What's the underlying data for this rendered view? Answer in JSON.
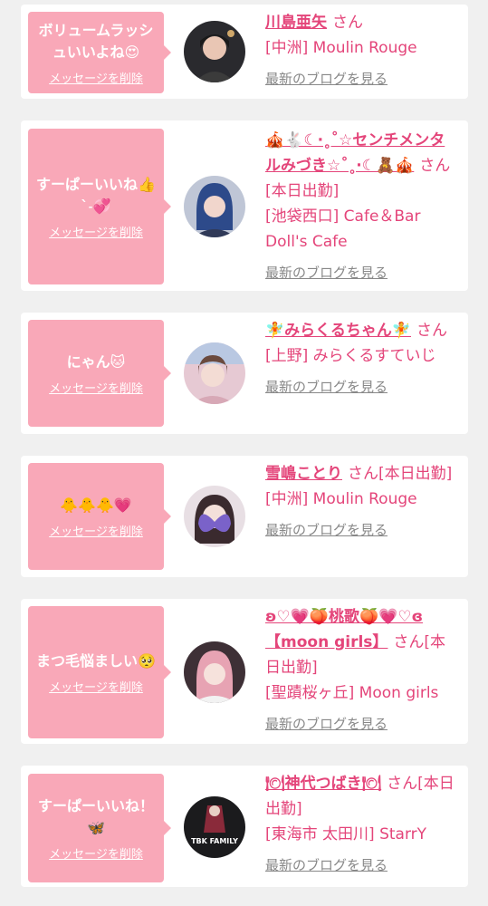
{
  "colors": {
    "page_bg": "#f0f0f0",
    "bubble_bg": "#f9a8b8",
    "accent_pink": "#e4457a",
    "link_gray": "#888888"
  },
  "common": {
    "delete_label": "メッセージを削除",
    "blog_label": "最新のブログを見る",
    "san": "さん"
  },
  "cards": [
    {
      "message": "ボリュームラッシュいいよね😍",
      "name": "川島亜矢",
      "status": "",
      "shop": "[中洲] Moulin Rouge",
      "avatar_icon": "woman-photo-avatar"
    },
    {
      "message": "すーぱーいいね👍 ˋ˗💞",
      "name": "🎪🐇☾·˳˚☆センチメンタルみづき☆˚˳·☾🧸🎪",
      "status": "[本日出勤]",
      "shop": "[池袋西口] Cafe＆Bar Doll's Cafe",
      "avatar_icon": "blue-hair-avatar"
    },
    {
      "message": "にゃん🐱",
      "name": "🧚みらくるちゃん🧚",
      "status": "",
      "shop": "[上野] みらくるすていじ",
      "avatar_icon": "idol-photo-avatar"
    },
    {
      "message": "🐥🐥🐥💗",
      "name": "雪嶋ことり",
      "status": "[本日出勤]",
      "shop": "[中洲] Moulin Rouge",
      "avatar_icon": "butterfly-face-avatar"
    },
    {
      "message": "まつ毛悩ましい🥺",
      "name": "ʚ♡💗🍑桃歌🍑💗♡ɞ【moon girls】",
      "status": "[本日出勤]",
      "shop": "[聖蹟桜ヶ丘] Moon girls",
      "avatar_icon": "pink-hair-avatar"
    },
    {
      "message": "すーぱーいいね！🦋",
      "name": "🍽神代つばき🍽",
      "status": "[本日出勤]",
      "shop": "[東海市 太田川] StarrY",
      "avatar_icon": "tbk-family-avatar",
      "avatar_text": "TBK FAMILY"
    }
  ]
}
